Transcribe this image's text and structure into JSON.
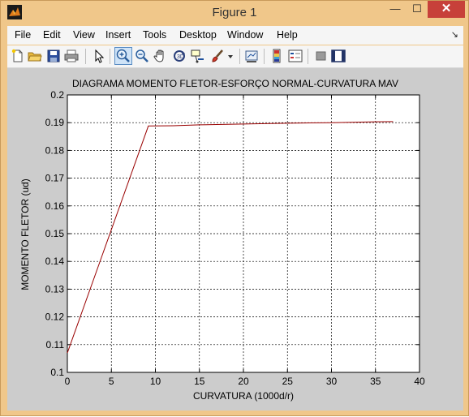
{
  "window": {
    "title": "Figure 1",
    "minimize_symbol": "—",
    "maximize_symbol": "☐",
    "close_symbol": "✕"
  },
  "menu": {
    "items": [
      "File",
      "Edit",
      "View",
      "Insert",
      "Tools",
      "Desktop",
      "Window",
      "Help"
    ],
    "overflow_arrow": "↘"
  },
  "toolbar": {
    "icons": [
      "new-figure-icon",
      "open-file-icon",
      "save-icon",
      "print-icon",
      "edit-plot-arrow-icon",
      "zoom-in-icon",
      "zoom-out-icon",
      "pan-hand-icon",
      "rotate-3d-icon",
      "data-cursor-icon",
      "brush-icon",
      "brush-dropdown-icon",
      "link-plot-icon",
      "colorbar-icon",
      "legend-icon",
      "hide-plot-tools-icon",
      "show-plot-tools-icon"
    ],
    "active": "zoom-in-icon"
  },
  "colors": {
    "title_bar": "#f0c78a",
    "figure_background": "#cccccc",
    "axes_background": "#ffffff",
    "line_color": "#990000",
    "close_button": "#c7403a"
  },
  "chart_data": {
    "type": "line",
    "title": "DIAGRAMA MOMENTO FLETOR-ESFORÇO NORMAL-CURVATURA MAV",
    "xlabel": "CURVATURA (1000d/r)",
    "ylabel": "MOMENTO FLETOR (ud)",
    "xlim": [
      0,
      40
    ],
    "ylim": [
      0.1,
      0.2
    ],
    "xticks": [
      0,
      5,
      10,
      15,
      20,
      25,
      30,
      35,
      40
    ],
    "yticks": [
      0.1,
      0.11,
      0.12,
      0.13,
      0.14,
      0.15,
      0.16,
      0.17,
      0.18,
      0.19,
      0.2
    ],
    "xtick_labels": [
      "0",
      "5",
      "10",
      "15",
      "20",
      "25",
      "30",
      "35",
      "40"
    ],
    "ytick_labels": [
      "0.1",
      "0.11",
      "0.12",
      "0.13",
      "0.14",
      "0.15",
      "0.16",
      "0.17",
      "0.18",
      "0.19",
      "0.2"
    ],
    "grid": true,
    "series": [
      {
        "color": "#990000",
        "x": [
          0,
          9.2,
          12,
          15,
          20,
          25,
          30,
          35,
          37
        ],
        "y": [
          0.107,
          0.1888,
          0.1889,
          0.1892,
          0.1895,
          0.1898,
          0.19,
          0.1903,
          0.1904
        ]
      }
    ]
  }
}
